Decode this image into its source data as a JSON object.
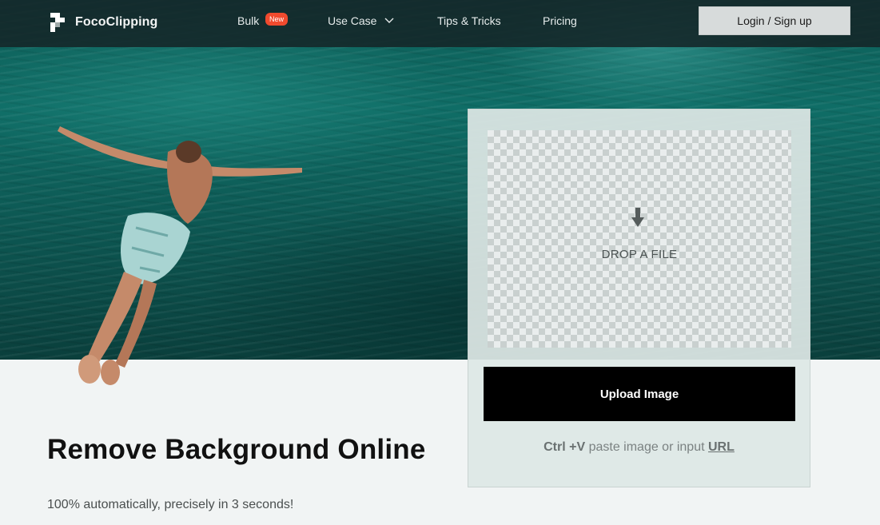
{
  "nav": {
    "brand": "FocoClipping",
    "items": [
      {
        "label": "Bulk",
        "badge": "New"
      },
      {
        "label": "Use Case",
        "has_dropdown": true
      },
      {
        "label": "Tips & Tricks"
      },
      {
        "label": "Pricing"
      }
    ],
    "login_label": "Login / Sign up"
  },
  "upload": {
    "drop_text": "DROP A FILE",
    "button_label": "Upload Image",
    "shortcut": "Ctrl +V",
    "paste_text": " paste image or input ",
    "url_label": "URL"
  },
  "hero": {
    "headline": "Remove Background Online",
    "subline": "100% automatically, precisely in 3 seconds!"
  },
  "colors": {
    "badge": "#f04a2e",
    "upload_button": "#000000",
    "navbar": "#142628",
    "sea": "#0f6d66"
  },
  "icons": [
    "logo-mark-icon",
    "chevron-down-icon",
    "download-arrow-icon"
  ]
}
